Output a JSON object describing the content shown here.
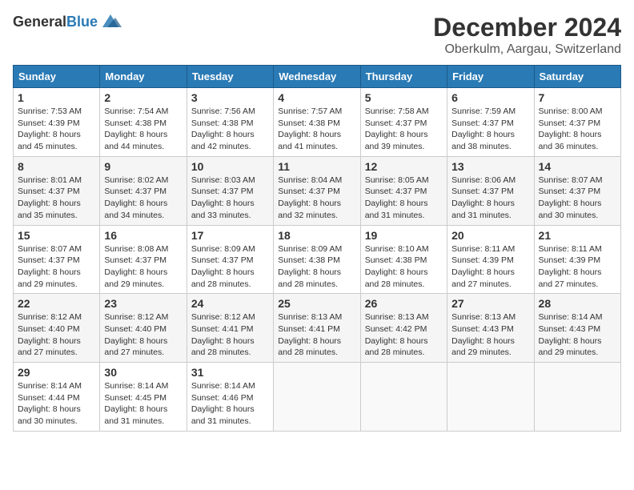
{
  "logo": {
    "text_general": "General",
    "text_blue": "Blue"
  },
  "title": {
    "month_year": "December 2024",
    "location": "Oberkulm, Aargau, Switzerland"
  },
  "days_header": [
    "Sunday",
    "Monday",
    "Tuesday",
    "Wednesday",
    "Thursday",
    "Friday",
    "Saturday"
  ],
  "weeks": [
    [
      {
        "day": "1",
        "sunrise": "Sunrise: 7:53 AM",
        "sunset": "Sunset: 4:39 PM",
        "daylight": "Daylight: 8 hours and 45 minutes."
      },
      {
        "day": "2",
        "sunrise": "Sunrise: 7:54 AM",
        "sunset": "Sunset: 4:38 PM",
        "daylight": "Daylight: 8 hours and 44 minutes."
      },
      {
        "day": "3",
        "sunrise": "Sunrise: 7:56 AM",
        "sunset": "Sunset: 4:38 PM",
        "daylight": "Daylight: 8 hours and 42 minutes."
      },
      {
        "day": "4",
        "sunrise": "Sunrise: 7:57 AM",
        "sunset": "Sunset: 4:38 PM",
        "daylight": "Daylight: 8 hours and 41 minutes."
      },
      {
        "day": "5",
        "sunrise": "Sunrise: 7:58 AM",
        "sunset": "Sunset: 4:37 PM",
        "daylight": "Daylight: 8 hours and 39 minutes."
      },
      {
        "day": "6",
        "sunrise": "Sunrise: 7:59 AM",
        "sunset": "Sunset: 4:37 PM",
        "daylight": "Daylight: 8 hours and 38 minutes."
      },
      {
        "day": "7",
        "sunrise": "Sunrise: 8:00 AM",
        "sunset": "Sunset: 4:37 PM",
        "daylight": "Daylight: 8 hours and 36 minutes."
      }
    ],
    [
      {
        "day": "8",
        "sunrise": "Sunrise: 8:01 AM",
        "sunset": "Sunset: 4:37 PM",
        "daylight": "Daylight: 8 hours and 35 minutes."
      },
      {
        "day": "9",
        "sunrise": "Sunrise: 8:02 AM",
        "sunset": "Sunset: 4:37 PM",
        "daylight": "Daylight: 8 hours and 34 minutes."
      },
      {
        "day": "10",
        "sunrise": "Sunrise: 8:03 AM",
        "sunset": "Sunset: 4:37 PM",
        "daylight": "Daylight: 8 hours and 33 minutes."
      },
      {
        "day": "11",
        "sunrise": "Sunrise: 8:04 AM",
        "sunset": "Sunset: 4:37 PM",
        "daylight": "Daylight: 8 hours and 32 minutes."
      },
      {
        "day": "12",
        "sunrise": "Sunrise: 8:05 AM",
        "sunset": "Sunset: 4:37 PM",
        "daylight": "Daylight: 8 hours and 31 minutes."
      },
      {
        "day": "13",
        "sunrise": "Sunrise: 8:06 AM",
        "sunset": "Sunset: 4:37 PM",
        "daylight": "Daylight: 8 hours and 31 minutes."
      },
      {
        "day": "14",
        "sunrise": "Sunrise: 8:07 AM",
        "sunset": "Sunset: 4:37 PM",
        "daylight": "Daylight: 8 hours and 30 minutes."
      }
    ],
    [
      {
        "day": "15",
        "sunrise": "Sunrise: 8:07 AM",
        "sunset": "Sunset: 4:37 PM",
        "daylight": "Daylight: 8 hours and 29 minutes."
      },
      {
        "day": "16",
        "sunrise": "Sunrise: 8:08 AM",
        "sunset": "Sunset: 4:37 PM",
        "daylight": "Daylight: 8 hours and 29 minutes."
      },
      {
        "day": "17",
        "sunrise": "Sunrise: 8:09 AM",
        "sunset": "Sunset: 4:37 PM",
        "daylight": "Daylight: 8 hours and 28 minutes."
      },
      {
        "day": "18",
        "sunrise": "Sunrise: 8:09 AM",
        "sunset": "Sunset: 4:38 PM",
        "daylight": "Daylight: 8 hours and 28 minutes."
      },
      {
        "day": "19",
        "sunrise": "Sunrise: 8:10 AM",
        "sunset": "Sunset: 4:38 PM",
        "daylight": "Daylight: 8 hours and 28 minutes."
      },
      {
        "day": "20",
        "sunrise": "Sunrise: 8:11 AM",
        "sunset": "Sunset: 4:39 PM",
        "daylight": "Daylight: 8 hours and 27 minutes."
      },
      {
        "day": "21",
        "sunrise": "Sunrise: 8:11 AM",
        "sunset": "Sunset: 4:39 PM",
        "daylight": "Daylight: 8 hours and 27 minutes."
      }
    ],
    [
      {
        "day": "22",
        "sunrise": "Sunrise: 8:12 AM",
        "sunset": "Sunset: 4:40 PM",
        "daylight": "Daylight: 8 hours and 27 minutes."
      },
      {
        "day": "23",
        "sunrise": "Sunrise: 8:12 AM",
        "sunset": "Sunset: 4:40 PM",
        "daylight": "Daylight: 8 hours and 27 minutes."
      },
      {
        "day": "24",
        "sunrise": "Sunrise: 8:12 AM",
        "sunset": "Sunset: 4:41 PM",
        "daylight": "Daylight: 8 hours and 28 minutes."
      },
      {
        "day": "25",
        "sunrise": "Sunrise: 8:13 AM",
        "sunset": "Sunset: 4:41 PM",
        "daylight": "Daylight: 8 hours and 28 minutes."
      },
      {
        "day": "26",
        "sunrise": "Sunrise: 8:13 AM",
        "sunset": "Sunset: 4:42 PM",
        "daylight": "Daylight: 8 hours and 28 minutes."
      },
      {
        "day": "27",
        "sunrise": "Sunrise: 8:13 AM",
        "sunset": "Sunset: 4:43 PM",
        "daylight": "Daylight: 8 hours and 29 minutes."
      },
      {
        "day": "28",
        "sunrise": "Sunrise: 8:14 AM",
        "sunset": "Sunset: 4:43 PM",
        "daylight": "Daylight: 8 hours and 29 minutes."
      }
    ],
    [
      {
        "day": "29",
        "sunrise": "Sunrise: 8:14 AM",
        "sunset": "Sunset: 4:44 PM",
        "daylight": "Daylight: 8 hours and 30 minutes."
      },
      {
        "day": "30",
        "sunrise": "Sunrise: 8:14 AM",
        "sunset": "Sunset: 4:45 PM",
        "daylight": "Daylight: 8 hours and 31 minutes."
      },
      {
        "day": "31",
        "sunrise": "Sunrise: 8:14 AM",
        "sunset": "Sunset: 4:46 PM",
        "daylight": "Daylight: 8 hours and 31 minutes."
      },
      null,
      null,
      null,
      null
    ]
  ]
}
